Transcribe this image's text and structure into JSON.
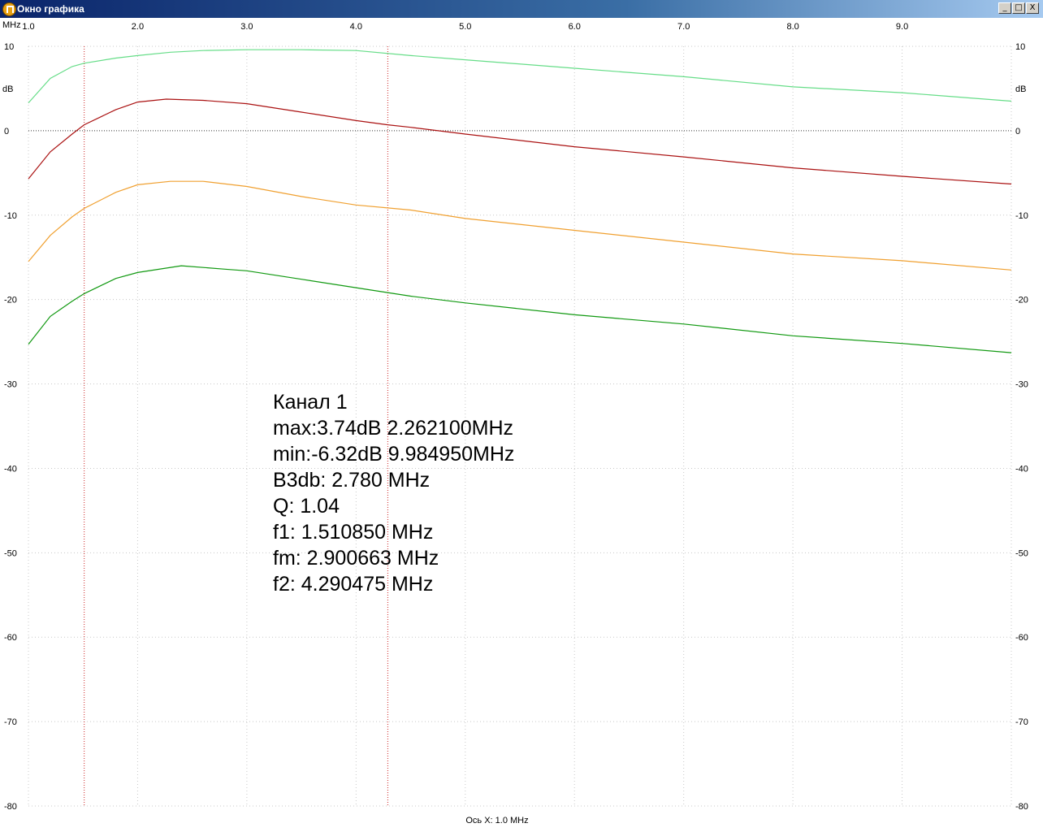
{
  "window": {
    "title": "Окно графика",
    "buttons": {
      "minimize": "_",
      "maximize": "□",
      "close": "X"
    }
  },
  "chart_data": {
    "type": "line",
    "x_unit_label": "MHz",
    "y_unit_label": "dB",
    "x_axis_caption": "Ось X: 1.0 MHz",
    "xlim": [
      1.0,
      10.0
    ],
    "ylim": [
      -80,
      10
    ],
    "x_ticks": [
      "1.0",
      "2.0",
      "3.0",
      "4.0",
      "5.0",
      "6.0",
      "7.0",
      "8.0",
      "9.0"
    ],
    "x_tick_values": [
      1,
      2,
      3,
      4,
      5,
      6,
      7,
      8,
      9
    ],
    "y_ticks": [
      "10",
      "0",
      "-10",
      "-20",
      "-30",
      "-40",
      "-50",
      "-60",
      "-70",
      "-80"
    ],
    "y_tick_values": [
      10,
      0,
      -10,
      -20,
      -30,
      -40,
      -50,
      -60,
      -70,
      -80
    ],
    "grid": true,
    "markers": [
      1.51085,
      4.290475
    ],
    "series": [
      {
        "color": "#66dd88",
        "x": [
          1.0,
          1.2,
          1.4,
          1.51,
          1.8,
          2.0,
          2.3,
          2.6,
          3.0,
          3.5,
          4.0,
          4.5,
          5.0,
          6.0,
          7.0,
          8.0,
          9.0,
          10.0
        ],
        "y": [
          3.3,
          6.2,
          7.6,
          8.0,
          8.6,
          8.9,
          9.3,
          9.5,
          9.6,
          9.6,
          9.5,
          8.9,
          8.4,
          7.4,
          6.4,
          5.2,
          4.5,
          3.5
        ]
      },
      {
        "color": "#aa1111",
        "x": [
          1.0,
          1.2,
          1.4,
          1.51,
          1.8,
          2.0,
          2.262,
          2.6,
          3.0,
          3.5,
          4.0,
          4.29,
          4.5,
          5.0,
          6.0,
          7.0,
          8.0,
          9.0,
          10.0
        ],
        "y": [
          -5.7,
          -2.5,
          -0.4,
          0.7,
          2.5,
          3.4,
          3.74,
          3.6,
          3.2,
          2.2,
          1.2,
          0.7,
          0.4,
          -0.4,
          -1.9,
          -3.1,
          -4.4,
          -5.4,
          -6.32
        ]
      },
      {
        "color": "#f0a030",
        "x": [
          1.0,
          1.2,
          1.4,
          1.51,
          1.8,
          2.0,
          2.3,
          2.6,
          3.0,
          3.5,
          4.0,
          4.5,
          5.0,
          6.0,
          7.0,
          8.0,
          9.0,
          10.0
        ],
        "y": [
          -15.5,
          -12.4,
          -10.2,
          -9.2,
          -7.3,
          -6.4,
          -6.0,
          -6.0,
          -6.6,
          -7.8,
          -8.8,
          -9.4,
          -10.4,
          -11.8,
          -13.2,
          -14.6,
          -15.4,
          -16.5
        ]
      },
      {
        "color": "#119911",
        "x": [
          1.0,
          1.2,
          1.4,
          1.51,
          1.8,
          2.0,
          2.4,
          2.8,
          3.0,
          3.5,
          4.0,
          4.5,
          5.0,
          6.0,
          7.0,
          8.0,
          9.0,
          10.0
        ],
        "y": [
          -25.3,
          -22.0,
          -20.2,
          -19.3,
          -17.5,
          -16.8,
          -16.0,
          -16.4,
          -16.6,
          -17.6,
          -18.6,
          -19.6,
          -20.4,
          -21.8,
          -22.9,
          -24.3,
          -25.2,
          -26.3
        ]
      }
    ],
    "annotation": [
      "Канал 1",
      "max:3.74dB 2.262100MHz",
      "min:-6.32dB 9.984950MHz",
      "B3db: 2.780 MHz",
      "Q: 1.04",
      "f1: 1.510850 MHz",
      "fm: 2.900663 MHz",
      "f2: 4.290475 MHz"
    ]
  }
}
